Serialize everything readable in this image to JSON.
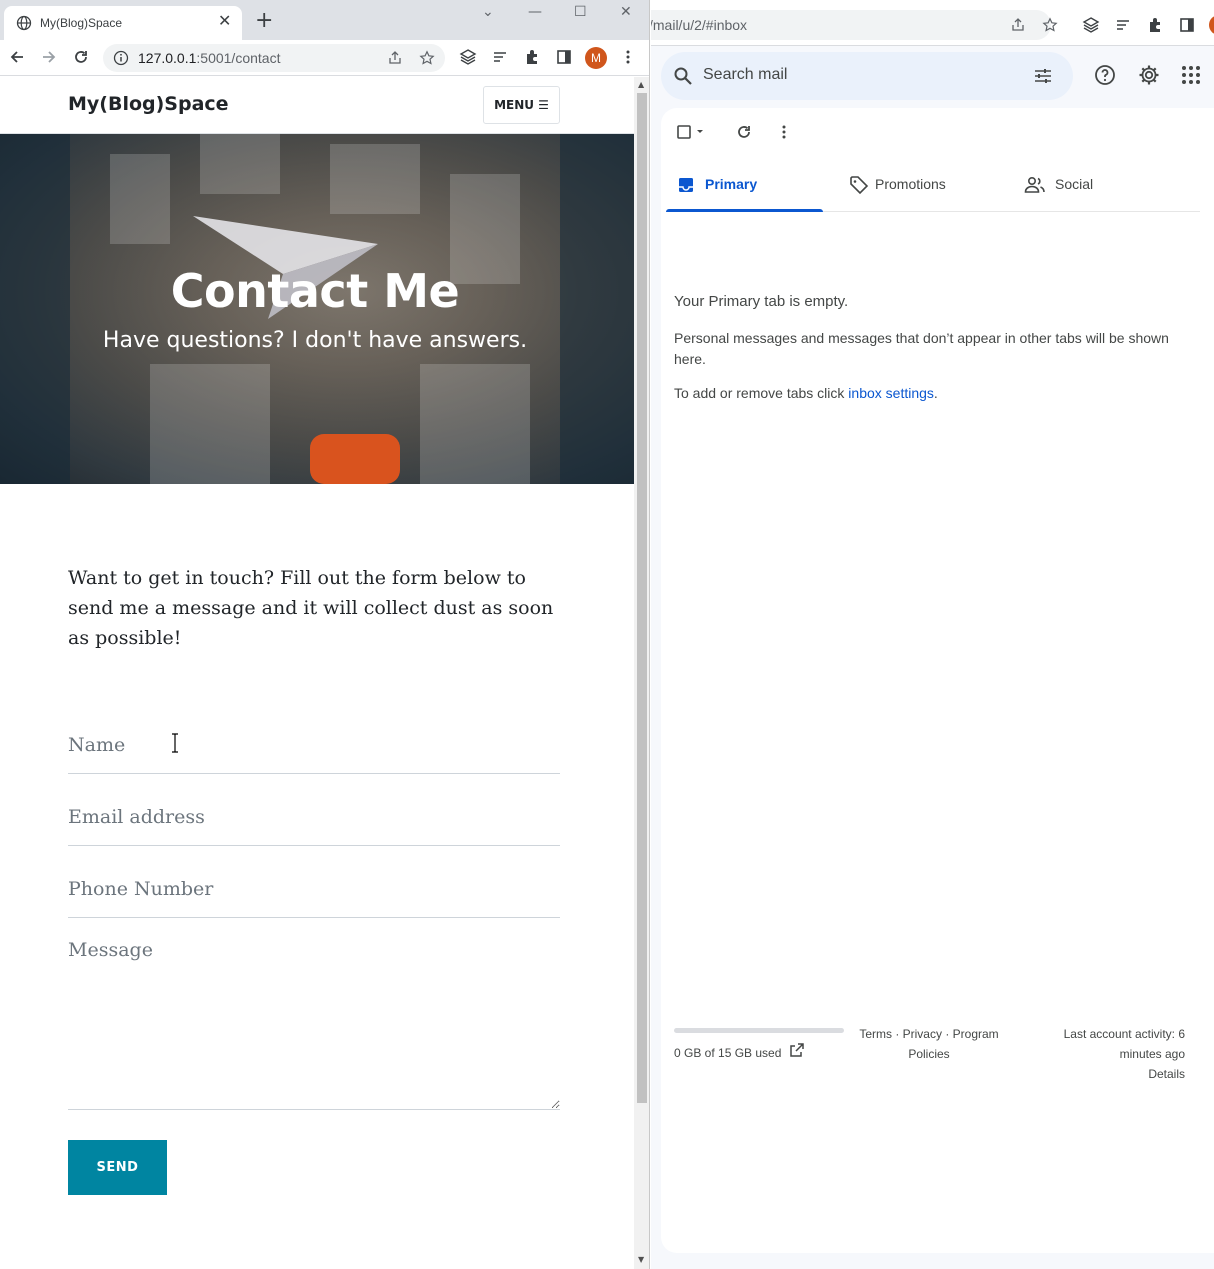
{
  "left_browser": {
    "tab_title": "My(Blog)Space",
    "tab_close": "✕",
    "new_tab": "+",
    "window_controls": {
      "tab_search": "⌄",
      "minimize": "—",
      "maximize": "☐",
      "close": "✕"
    },
    "url_host": "127.0.0.1",
    "url_path": ":5001/contact",
    "profile_initial": "M"
  },
  "site": {
    "brand": "My(Blog)Space",
    "menu_label": "MENU ☰",
    "hero_title": "Contact Me",
    "hero_subtitle": "Have questions? I don't have answers.",
    "intro": "Want to get in touch? Fill out the form below to send me a message and it will collect dust as soon as possible!",
    "form": {
      "name_placeholder": "Name",
      "email_placeholder": "Email address",
      "phone_placeholder": "Phone Number",
      "message_placeholder": "Message",
      "send_label": "SEND"
    }
  },
  "right_browser": {
    "url": "/mail/u/2/#inbox"
  },
  "gmail": {
    "search_placeholder": "Search mail",
    "tabs": [
      {
        "label": "Primary",
        "icon": "inbox-icon",
        "active": true
      },
      {
        "label": "Promotions",
        "icon": "tag-icon",
        "active": false
      },
      {
        "label": "Social",
        "icon": "people-icon",
        "active": false
      }
    ],
    "empty_title": "Your Primary tab is empty.",
    "empty_desc": "Personal messages and messages that don’t appear in other tabs will be shown here.",
    "empty_settings_prefix": "To add or remove tabs click ",
    "empty_settings_link": "inbox settings",
    "empty_settings_suffix": ".",
    "storage": {
      "text": "0 GB of 15 GB used",
      "used_fraction": 0.0
    },
    "footer_links": "Terms · Privacy · Program Policies",
    "activity": "Last account activity: 6 minutes ago",
    "details": "Details"
  },
  "colors": {
    "send_button": "#0085a1",
    "gmail_accent": "#0b57d0",
    "avatar": "#d0561c"
  }
}
